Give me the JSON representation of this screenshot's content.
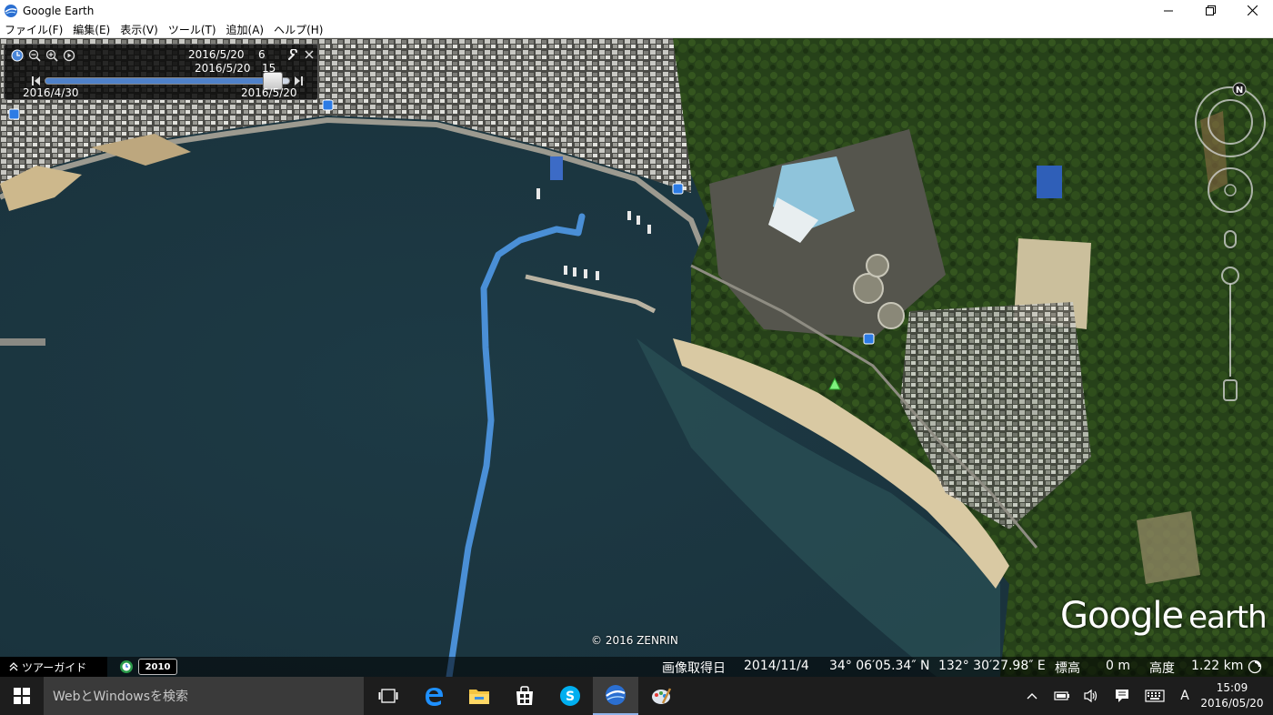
{
  "window": {
    "title": "Google Earth"
  },
  "menu": [
    "ファイル(F)",
    "編集(E)",
    "表示(V)",
    "ツール(T)",
    "追加(A)",
    "ヘルプ(H)"
  ],
  "time_slider": {
    "current_date": "2016/5/20",
    "current_hour": "6",
    "end_date_line": "2016/5/20",
    "end_hour": "15",
    "range_start": "2016/4/30",
    "range_end": "2016/5/20",
    "position_fraction": 0.93,
    "fill_color": "#4f81c9"
  },
  "map": {
    "copyright": "© 2016 ZENRIN",
    "logo_word1": "Google",
    "logo_word2": "earth",
    "track_color": "#4a8fd6",
    "water_color": "#1e3b46",
    "forest_color": "#2c4a1f",
    "beach_color": "#d9c9a3"
  },
  "statusbar": {
    "tour_guide": "ツアーガイド",
    "year_badge": "2010",
    "imagery_date_label": "画像取得日",
    "imagery_date": "2014/11/4",
    "latitude": "34° 06′05.34″ N",
    "longitude": "132° 30′27.98″ E",
    "elevation_label": "標高",
    "elevation": "0 m",
    "altitude_label": "高度",
    "altitude": "1.22 km"
  },
  "nav": {
    "north_label": "N"
  },
  "taskbar": {
    "search_placeholder": "WebとWindowsを検索",
    "ime_label": "A",
    "clock_time": "15:09",
    "clock_date": "2016/05/20",
    "icons": [
      "task-view-icon",
      "edge-icon",
      "file-explorer-icon",
      "store-icon",
      "skype-icon",
      "google-earth-icon",
      "paint-icon"
    ]
  }
}
